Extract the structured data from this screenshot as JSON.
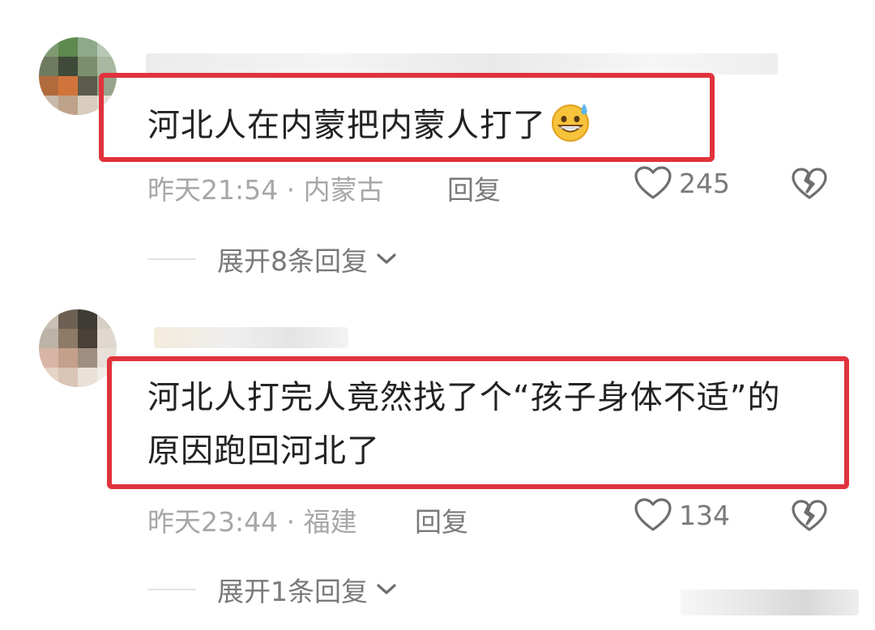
{
  "comments": [
    {
      "text": "河北人在内蒙把内蒙人打了",
      "emoji": "grinning-sweat-emoji",
      "time_location": "昨天21:54 · 内蒙古",
      "reply_label": "回复",
      "likes": "245",
      "expand_label": "展开8条回复"
    },
    {
      "text_line1": "河北人打完人竟然找了个“孩子身体不适”的",
      "text_line2": "原因跑回河北了",
      "time_location": "昨天23:44 · 福建",
      "reply_label": "回复",
      "likes": "134",
      "expand_label": "展开1条回复"
    }
  ],
  "colors": {
    "highlight": "#e0323c",
    "text": "#222222",
    "meta": "#a7a7a7",
    "action": "#7a7a7a"
  },
  "icons": [
    "heart-outline-icon",
    "broken-heart-icon",
    "chevron-down-icon"
  ]
}
